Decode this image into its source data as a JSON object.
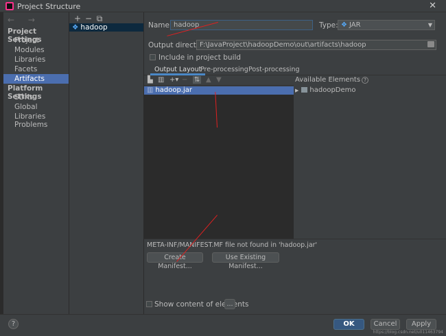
{
  "window": {
    "title": "Project Structure",
    "close_glyph": "✕"
  },
  "nav": {
    "arrows": "← →",
    "project_settings_header": "Project Settings",
    "project_items": [
      "Project",
      "Modules",
      "Libraries",
      "Facets",
      "Artifacts"
    ],
    "platform_settings_header": "Platform Settings",
    "platform_items": [
      "SDKs",
      "Global Libraries"
    ],
    "problems": "Problems",
    "selected": "Artifacts"
  },
  "artifacts": {
    "toolbar": [
      "+",
      "−",
      "⧉"
    ],
    "items": [
      {
        "name": "hadoop",
        "icon": "jar-gem-icon"
      }
    ]
  },
  "artifact_form": {
    "name_label": "Name:",
    "name_value": "hadoop",
    "type_label": "Type:",
    "type_value": "JAR",
    "output_dir_label": "Output directory:",
    "output_dir_value": "F:\\JavaProject\\hadoopDemo\\out\\artifacts\\hadoop",
    "include_in_build_label": "Include in project build",
    "include_in_build_checked": false
  },
  "tabs": [
    "Output Layout",
    "Pre-processing",
    "Post-processing"
  ],
  "active_tab": "Output Layout",
  "output_layout": {
    "tree_items": [
      {
        "name": "hadoop.jar",
        "icon": "jar-icon"
      }
    ]
  },
  "available_elements": {
    "title": "Available Elements",
    "items": [
      {
        "name": "hadoopDemo",
        "icon": "folder-icon",
        "expanded": false
      }
    ]
  },
  "manifest": {
    "message": "META-INF/MANIFEST.MF file not found in 'hadoop.jar'",
    "create_button": "Create Manifest...",
    "use_existing_button": "Use Existing Manifest..."
  },
  "show_content": {
    "label": "Show content of elements",
    "checked": false,
    "ellipsis_button": "..."
  },
  "footer": {
    "help": "?",
    "ok": "OK",
    "cancel": "Cancel",
    "apply": "Apply",
    "watermark": "https://blog.csdn.net/u011463794"
  },
  "colors": {
    "background": "#3c3f41",
    "selection": "#4b6eaf",
    "ok_button": "#365880",
    "annotation_arrow": "#e02020"
  }
}
